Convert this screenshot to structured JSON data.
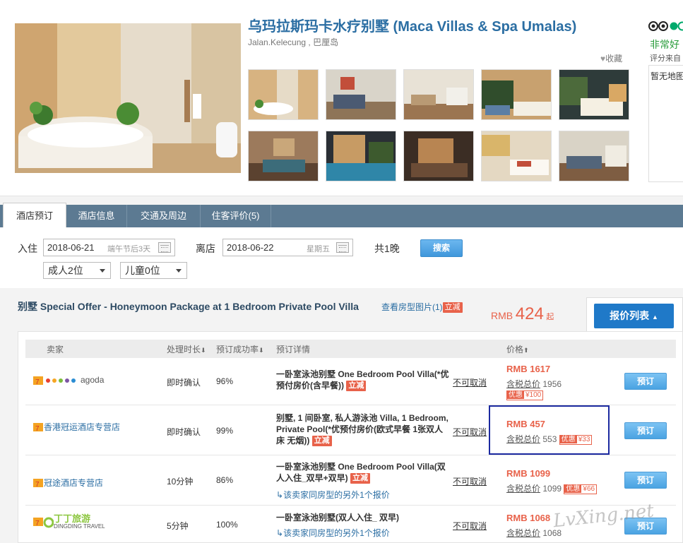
{
  "hotel": {
    "title": "乌玛拉斯玛卡水疗别墅 (Maca Villas & Spa Umalas)",
    "address": "Jalan.Kelecung , 巴厘岛",
    "favorite_label": "收藏",
    "rating_text": "非常好",
    "rating_source": "评分来自",
    "map_text": "暂无地图"
  },
  "tabs": [
    {
      "label": "酒店预订"
    },
    {
      "label": "酒店信息"
    },
    {
      "label": "交通及周边"
    },
    {
      "label": "住客评价(5)"
    }
  ],
  "search": {
    "checkin_label": "入住",
    "checkin_value": "2018-06-21",
    "checkin_hint": "端午节后3天",
    "checkout_label": "离店",
    "checkout_value": "2018-06-22",
    "checkout_hint": "星期五",
    "nights": "共1晚",
    "search_button": "搜索",
    "adults": "成人2位",
    "children": "儿童0位"
  },
  "room": {
    "title": "别墅 Special Offer - Honeymoon Package at 1 Bedroom Private Pool Villa",
    "photos_link": "查看房型图片(1)",
    "badge": "立减",
    "lowest_currency": "RMB",
    "lowest_price": "424",
    "lowest_suffix": "起",
    "price_list_button": "报价列表"
  },
  "table_headers": {
    "seller": "卖家",
    "process_time": "处理时长",
    "success_rate": "预订成功率",
    "details": "预订详情",
    "price": "价格"
  },
  "offers": [
    {
      "seller": "agoda",
      "process_time": "即时确认",
      "success_rate": "96%",
      "detail": "一卧室泳池别墅 One Bedroom Pool Villa(*优预付房价(含早餐))",
      "badge": "立减",
      "cancel": "不可取消",
      "price": "RMB 1617",
      "tax_label": "含税总价",
      "tax_total": "1956",
      "discount_label": "优惠",
      "discount_value": "¥100",
      "book": "预订"
    },
    {
      "seller": "香港冠运酒店专营店",
      "process_time": "即时确认",
      "success_rate": "99%",
      "detail": "别墅, 1 间卧室, 私人游泳池 Villa, 1 Bedroom, Private Pool(*优预付房价(欧式早餐 1张双人床 无烟))",
      "badge": "立减",
      "cancel": "不可取消",
      "price": "RMB 457",
      "tax_label": "含税总价",
      "tax_total": "553",
      "discount_label": "优惠",
      "discount_value": "¥33",
      "book": "预订"
    },
    {
      "seller": "冠途酒店专营店",
      "process_time": "10分钟",
      "success_rate": "86%",
      "detail": "一卧室泳池别墅 One Bedroom Pool Villa(双人入住_双早+双早)",
      "badge": "立减",
      "more_link": "该卖家同房型的另外1个报价",
      "cancel": "不可取消",
      "price": "RMB 1099",
      "tax_label": "含税总价",
      "tax_total": "1099",
      "discount_label": "优惠",
      "discount_value": "¥66",
      "book": "预订"
    },
    {
      "seller": "丁丁旅游",
      "seller_sub": "DINGDING TRAVEL",
      "process_time": "5分钟",
      "success_rate": "100%",
      "detail": "一卧室泳池别墅(双人入住_ 双早)",
      "more_link": "该卖家同房型的另外1个报价",
      "cancel": "不可取消",
      "price": "RMB 1068",
      "tax_label": "含税总价",
      "tax_total": "1068",
      "book": "预订"
    }
  ],
  "watermark": "LvXing.net"
}
